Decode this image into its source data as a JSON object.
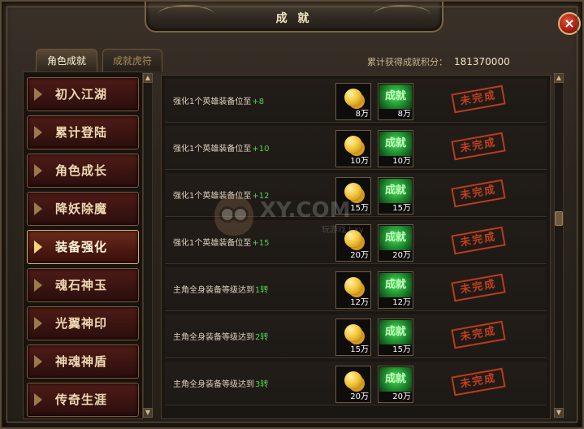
{
  "window": {
    "title": "成 就",
    "close_glyph": "×"
  },
  "tabs": [
    {
      "label": "角色成就",
      "active": true
    },
    {
      "label": "成就虎符",
      "active": false
    }
  ],
  "total": {
    "label": "累计获得成就积分：",
    "value": "181370000"
  },
  "sidebar": {
    "items": [
      {
        "label": "初入江湖",
        "active": false
      },
      {
        "label": "累计登陆",
        "active": false
      },
      {
        "label": "角色成长",
        "active": false
      },
      {
        "label": "降妖除魔",
        "active": false
      },
      {
        "label": "装备强化",
        "active": true
      },
      {
        "label": "魂石神玉",
        "active": false
      },
      {
        "label": "光翼神印",
        "active": false
      },
      {
        "label": "神魂神盾",
        "active": false
      },
      {
        "label": "传奇生涯",
        "active": false
      }
    ]
  },
  "achievements": [
    {
      "label": "强化1个英雄装备位至",
      "suffix": "+8",
      "gold": "8万",
      "points": "8万",
      "icon_text": "成就",
      "status": "未完成"
    },
    {
      "label": "强化1个英雄装备位至",
      "suffix": "+10",
      "gold": "10万",
      "points": "10万",
      "icon_text": "成就",
      "status": "未完成"
    },
    {
      "label": "强化1个英雄装备位至",
      "suffix": "+12",
      "gold": "15万",
      "points": "15万",
      "icon_text": "成就",
      "status": "未完成"
    },
    {
      "label": "强化1个英雄装备位至",
      "suffix": "+15",
      "gold": "20万",
      "points": "20万",
      "icon_text": "成就",
      "status": "未完成"
    },
    {
      "label": "主角全身装备等级达到",
      "suffix": "1转",
      "gold": "12万",
      "points": "12万",
      "icon_text": "成就",
      "status": "未完成"
    },
    {
      "label": "主角全身装备等级达到",
      "suffix": "2转",
      "gold": "15万",
      "points": "15万",
      "icon_text": "成就",
      "status": "未完成"
    },
    {
      "label": "主角全身装备等级达到",
      "suffix": "3转",
      "gold": "20万",
      "points": "20万",
      "icon_text": "成就",
      "status": "未完成"
    }
  ],
  "scroll": {
    "up_glyph": "▲",
    "down_glyph": "▼"
  },
  "watermark": {
    "text": "XY.COM",
    "subtext": "玩游戏上xy"
  },
  "colors": {
    "accent_gold": "#d8b35e",
    "completed_green": "#4fd24f",
    "stamp_red": "#d4441f"
  }
}
